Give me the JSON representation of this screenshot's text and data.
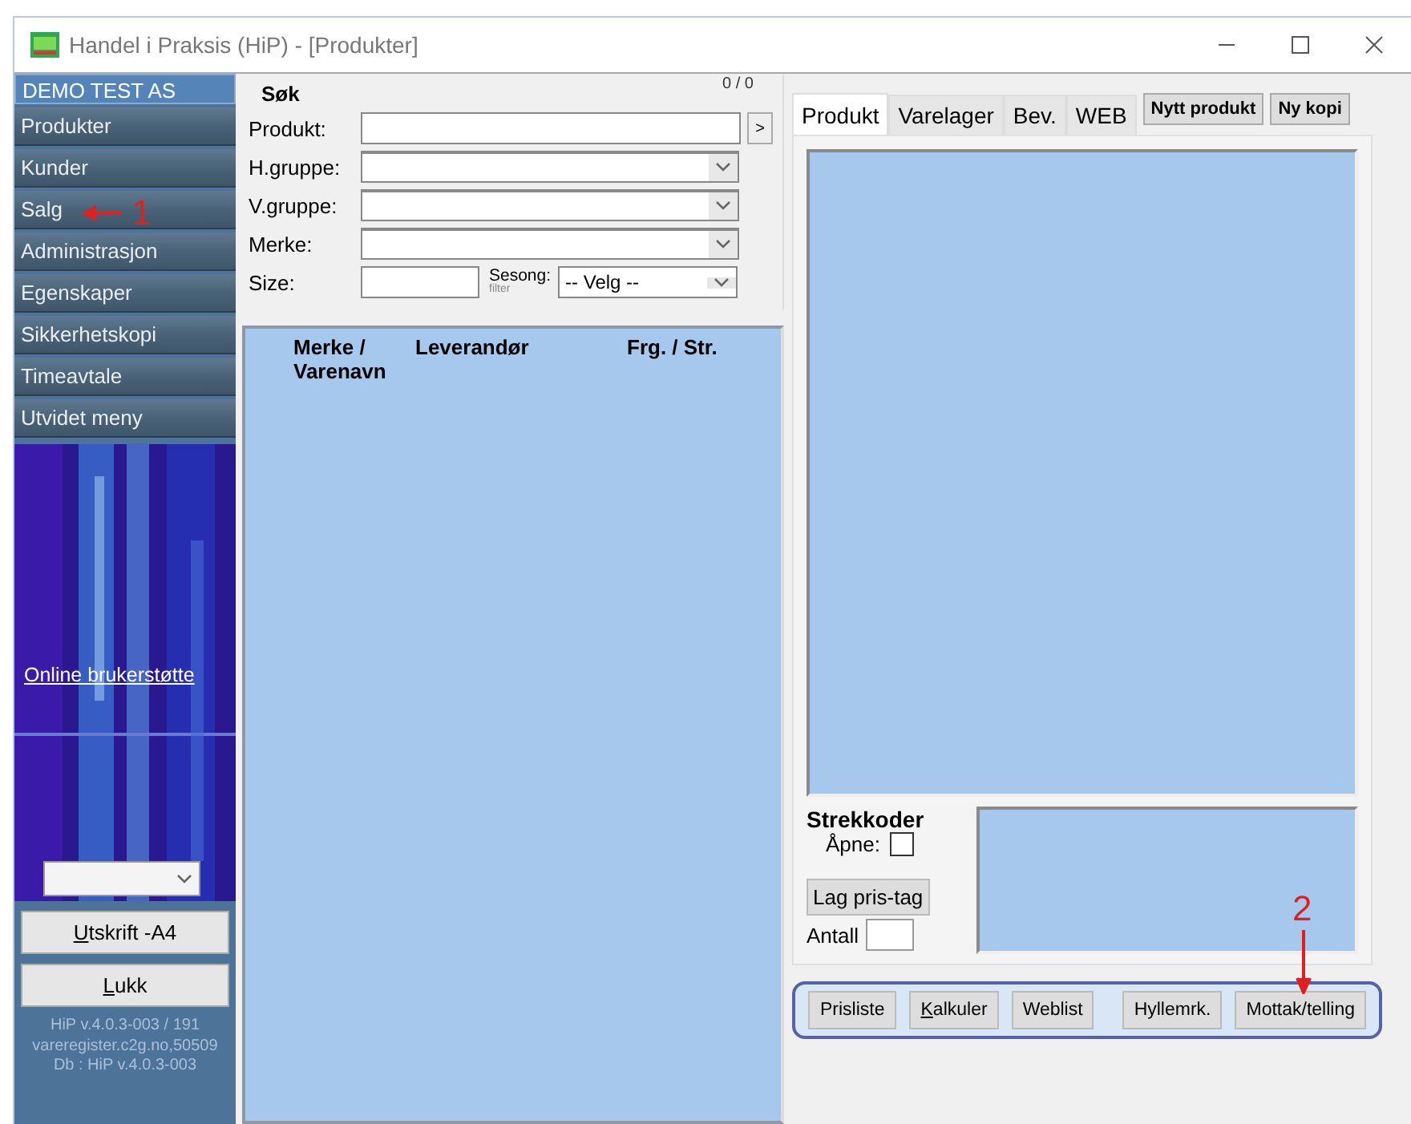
{
  "window": {
    "title": "Handel i Praksis (HiP) - [Produkter]"
  },
  "sidebar": {
    "company": "DEMO TEST AS",
    "items": [
      {
        "label": "Produkter"
      },
      {
        "label": "Kunder"
      },
      {
        "label": "Salg"
      },
      {
        "label": "Administrasjon"
      },
      {
        "label": "Egenskaper"
      },
      {
        "label": "Sikkerhetskopi"
      },
      {
        "label": "Timeavtale"
      },
      {
        "label": "Utvidet meny"
      }
    ],
    "support_link": "Online brukerstøtte",
    "buttons": [
      {
        "label": "Utskrift -A4",
        "underline_first": true
      },
      {
        "label": "Lukk",
        "underline_first": true
      }
    ],
    "version_lines": [
      "HiP v.4.0.3-003 / 191",
      "vareregister.c2g.no,50509",
      "Db : HiP v.4.0.3-003"
    ]
  },
  "search": {
    "title": "Søk",
    "counter": "0 / 0",
    "fields": [
      {
        "label": "Produkt:",
        "kind": "text"
      },
      {
        "label": "H.gruppe:",
        "kind": "combo"
      },
      {
        "label": "V.gruppe:",
        "kind": "combo"
      },
      {
        "label": "Merke:",
        "kind": "combo"
      }
    ],
    "go_button": ">",
    "size_label": "Size:",
    "season_label": "Sesong:",
    "season_sub": "filter",
    "season_value": "-- Velg --"
  },
  "list": {
    "columns": [
      "Merke / Varenavn",
      "Leverandør",
      "Frg. / Str."
    ]
  },
  "tabs": [
    {
      "label": "Produkt",
      "selected": true
    },
    {
      "label": "Varelager",
      "selected": false
    },
    {
      "label": "Bev.",
      "selected": false
    },
    {
      "label": "WEB",
      "selected": false
    }
  ],
  "tab_buttons": [
    "Nytt produkt",
    "Ny kopi"
  ],
  "barcodes": {
    "title": "Strekkoder",
    "open_label": "Åpne:",
    "open_checked": false,
    "tag_button": "Lag pris-tag",
    "count_label": "Antall"
  },
  "bottom_buttons": [
    {
      "label": "Prisliste",
      "underline_first": false
    },
    {
      "label": "Kalkuler",
      "underline_first": true
    },
    {
      "label": "Weblist",
      "underline_first": false
    },
    {
      "label": "Hyllemrk.",
      "underline_first": false
    },
    {
      "label": "Mottak/telling",
      "underline_first": false
    }
  ],
  "annotations": [
    {
      "label": "1"
    },
    {
      "label": "2"
    }
  ]
}
